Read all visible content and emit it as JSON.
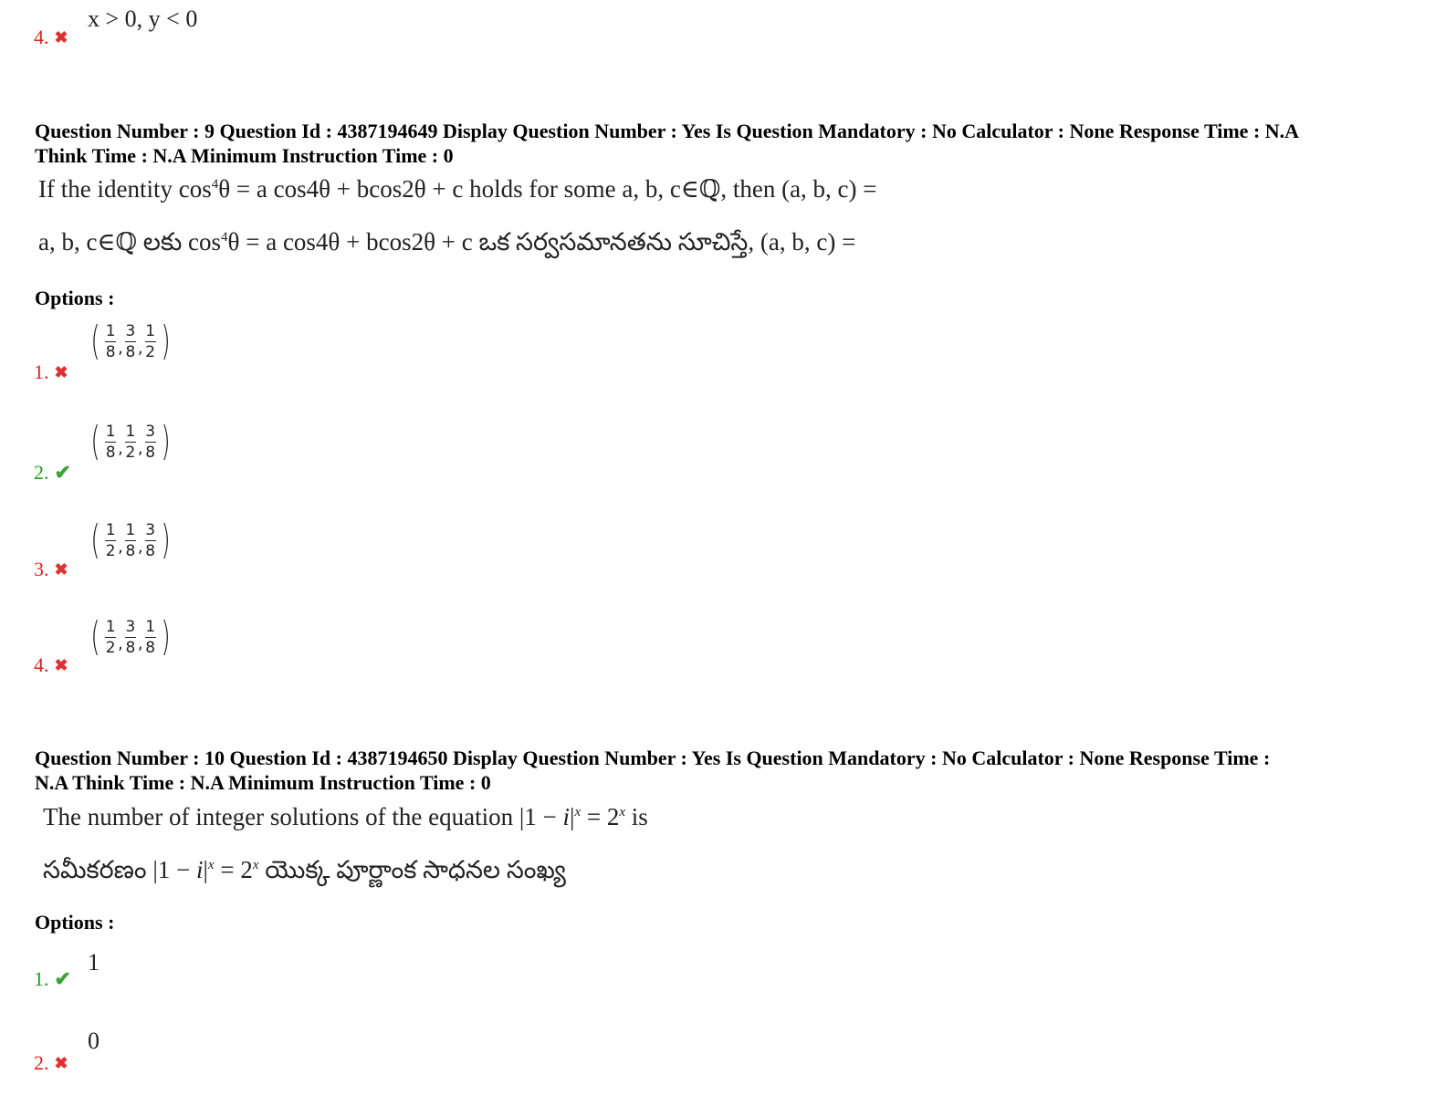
{
  "prev_question": {
    "option4": {
      "number": "4.",
      "status": "wrong",
      "text": "x > 0, y < 0"
    }
  },
  "question9": {
    "meta_line1": "Question Number : 9 Question Id : 4387194649 Display Question Number : Yes Is Question Mandatory : No Calculator : None Response Time : N.A",
    "meta_line2": "Think Time : N.A Minimum Instruction Time : 0",
    "english": {
      "pre": "If the identity cos",
      "sup": "4",
      "post": "θ = a cos4θ + bcos2θ + c holds for some a, b, c∈ℚ, then (a, b, c) ="
    },
    "telugu": {
      "pre": "a, b, c∈ℚ లకు cos",
      "sup": "4",
      "post": "θ = a cos4θ + bcos2θ + c ఒక సర్వసమానతను సూచిస్తే, (a, b, c) ="
    },
    "options_label": "Options :",
    "options": [
      {
        "number": "1.",
        "status": "wrong",
        "fracs": [
          [
            "1",
            "8"
          ],
          [
            "3",
            "8"
          ],
          [
            "1",
            "2"
          ]
        ]
      },
      {
        "number": "2.",
        "status": "correct",
        "fracs": [
          [
            "1",
            "8"
          ],
          [
            "1",
            "2"
          ],
          [
            "3",
            "8"
          ]
        ]
      },
      {
        "number": "3.",
        "status": "wrong",
        "fracs": [
          [
            "1",
            "2"
          ],
          [
            "1",
            "8"
          ],
          [
            "3",
            "8"
          ]
        ]
      },
      {
        "number": "4.",
        "status": "wrong",
        "fracs": [
          [
            "1",
            "2"
          ],
          [
            "3",
            "8"
          ],
          [
            "1",
            "8"
          ]
        ]
      }
    ]
  },
  "question10": {
    "meta_line1": "Question Number : 10 Question Id : 4387194650 Display Question Number : Yes Is Question Mandatory : No Calculator : None Response Time :",
    "meta_line2": "N.A Think Time : N.A Minimum Instruction Time : 0",
    "english": {
      "pre": "The number of integer solutions of the equation |1 − ",
      "i": "i",
      "mid": "|",
      "sup1": "x",
      "eq": " = 2",
      "sup2": "x",
      "post": " is"
    },
    "telugu": {
      "pre": "సమీకరణం |1 − ",
      "i": "i",
      "mid": "|",
      "sup1": "x",
      "eq": " = 2",
      "sup2": "x",
      "post": " యొక్క పూర్ణాంక సాధనల సంఖ్య"
    },
    "options_label": "Options :",
    "options": [
      {
        "number": "1.",
        "status": "correct",
        "text": "1"
      },
      {
        "number": "2.",
        "status": "wrong",
        "text": "0"
      }
    ]
  },
  "icons": {
    "wrong": "✖",
    "correct": "✔"
  },
  "colors": {
    "wrong": "#e02020",
    "correct": "#1f9d1f"
  }
}
